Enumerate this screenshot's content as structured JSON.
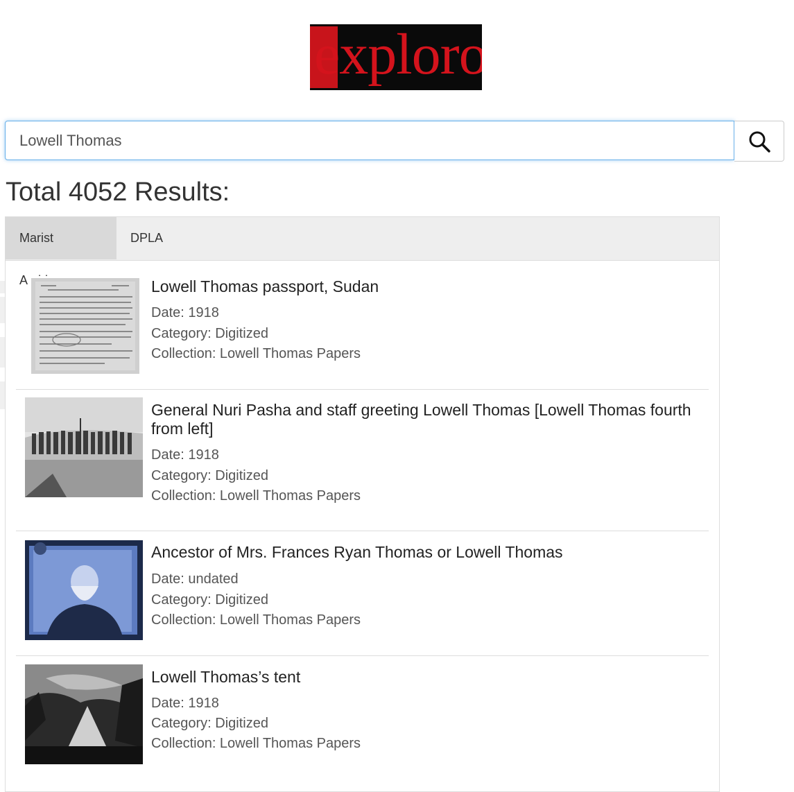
{
  "logo": {
    "text": "exploro"
  },
  "search": {
    "value": "Lowell Thomas",
    "button_icon": "search-icon"
  },
  "results_header": "Total 4052 Results:",
  "tabs": [
    {
      "label": "Marist Archives",
      "active": true
    },
    {
      "label": "DPLA",
      "active": false
    }
  ],
  "results": [
    {
      "title": "Lowell Thomas passport, Sudan",
      "date": "Date: 1918",
      "category": "Category: Digitized",
      "collection": "Collection: Lowell Thomas Papers",
      "thumb": "document-photo"
    },
    {
      "title": "General Nuri Pasha and staff greeting Lowell Thomas [Lowell Thomas fourth from left]",
      "date": "Date: 1918",
      "category": "Category: Digitized",
      "collection": "Collection: Lowell Thomas Papers",
      "thumb": "group-photo"
    },
    {
      "title": "Ancestor of Mrs. Frances Ryan Thomas or Lowell Thomas",
      "date": "Date: undated",
      "category": "Category: Digitized",
      "collection": "Collection: Lowell Thomas Papers",
      "thumb": "portrait-photo"
    },
    {
      "title": "Lowell Thomas’s tent",
      "date": "Date: 1918",
      "category": "Category: Digitized",
      "collection": "Collection: Lowell Thomas Papers",
      "thumb": "tent-photo"
    }
  ]
}
